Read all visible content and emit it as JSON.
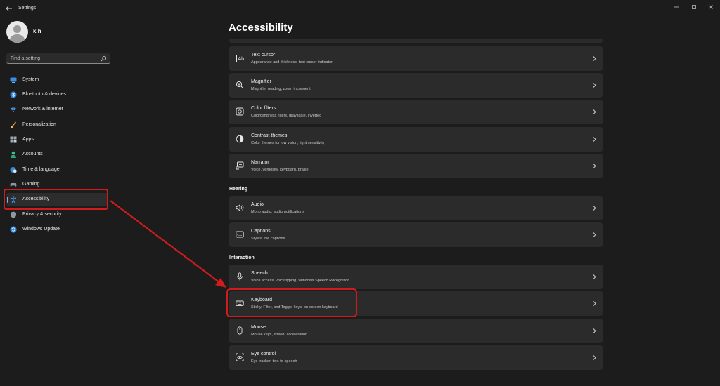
{
  "window": {
    "title": "Settings"
  },
  "user": {
    "name": "k h"
  },
  "search": {
    "placeholder": "Find a setting"
  },
  "sidebar": {
    "items": [
      {
        "label": "System",
        "icon": "monitor-icon"
      },
      {
        "label": "Bluetooth & devices",
        "icon": "bluetooth-icon"
      },
      {
        "label": "Network & internet",
        "icon": "wifi-icon"
      },
      {
        "label": "Personalization",
        "icon": "brush-icon"
      },
      {
        "label": "Apps",
        "icon": "apps-icon"
      },
      {
        "label": "Accounts",
        "icon": "person-icon"
      },
      {
        "label": "Time & language",
        "icon": "globe-clock-icon"
      },
      {
        "label": "Gaming",
        "icon": "gamepad-icon"
      },
      {
        "label": "Accessibility",
        "icon": "accessibility-icon",
        "active": true
      },
      {
        "label": "Privacy & security",
        "icon": "shield-icon"
      },
      {
        "label": "Windows Update",
        "icon": "update-icon"
      }
    ]
  },
  "main": {
    "title": "Accessibility",
    "vision_cards": [
      {
        "title": "Text cursor",
        "subtitle": "Appearance and thickness, text cursor indicator",
        "icon": "text-cursor-icon"
      },
      {
        "title": "Magnifier",
        "subtitle": "Magnifier reading, zoom increment",
        "icon": "magnifier-icon"
      },
      {
        "title": "Color filters",
        "subtitle": "Colorblindness filters, grayscale, inverted",
        "icon": "color-filters-icon"
      },
      {
        "title": "Contrast themes",
        "subtitle": "Color themes for low vision, light sensitivity",
        "icon": "contrast-icon"
      },
      {
        "title": "Narrator",
        "subtitle": "Voice, verbosity, keyboard, braille",
        "icon": "narrator-icon"
      }
    ],
    "hearing": {
      "heading": "Hearing",
      "cards": [
        {
          "title": "Audio",
          "subtitle": "Mono audio, audio notifications",
          "icon": "speaker-icon"
        },
        {
          "title": "Captions",
          "subtitle": "Styles, live captions",
          "icon": "captions-icon"
        }
      ]
    },
    "interaction": {
      "heading": "Interaction",
      "cards": [
        {
          "title": "Speech",
          "subtitle": "Voice access, voice typing, Windows Speech Recognition",
          "icon": "microphone-icon"
        },
        {
          "title": "Keyboard",
          "subtitle": "Sticky, Filter, and Toggle keys, on-screen keyboard",
          "icon": "keyboard-icon"
        },
        {
          "title": "Mouse",
          "subtitle": "Mouse keys, speed, acceleration",
          "icon": "mouse-icon"
        },
        {
          "title": "Eye control",
          "subtitle": "Eye tracker, text-to-speech",
          "icon": "eye-control-icon"
        }
      ]
    }
  },
  "colors": {
    "background": "#1c1c1c",
    "card": "#2b2b2b",
    "accent": "#6cb8ff",
    "annotation": "#d01c1c"
  }
}
